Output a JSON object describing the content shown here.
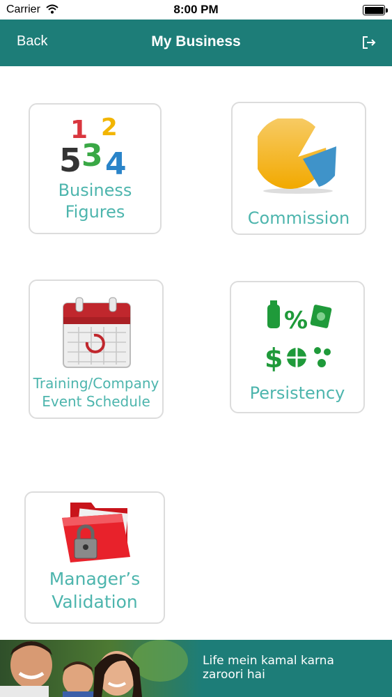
{
  "status_bar": {
    "carrier": "Carrier",
    "time": "8:00 PM"
  },
  "nav": {
    "back_label": "Back",
    "title": "My Business",
    "logout_icon": "logout-icon"
  },
  "tiles": {
    "business_figures": {
      "line1": "Business",
      "line2": "Figures",
      "icon": "numbers-icon"
    },
    "commission": {
      "label": "Commission",
      "icon": "pie-chart-icon"
    },
    "training": {
      "line1": "Training/Company",
      "line2": "Event Schedule",
      "icon": "calendar-icon"
    },
    "persistency": {
      "label": "Persistency",
      "icon": "money-symbols-icon"
    },
    "validation": {
      "line1": "Manager’s",
      "line2": "Validation",
      "icon": "locked-folder-icon"
    }
  },
  "banner": {
    "line1": "Life mein kamal karna",
    "line2": "zaroori hai"
  },
  "colors": {
    "header": "#1d7d78",
    "label": "#4db5ad",
    "border": "#dcdcdc"
  }
}
